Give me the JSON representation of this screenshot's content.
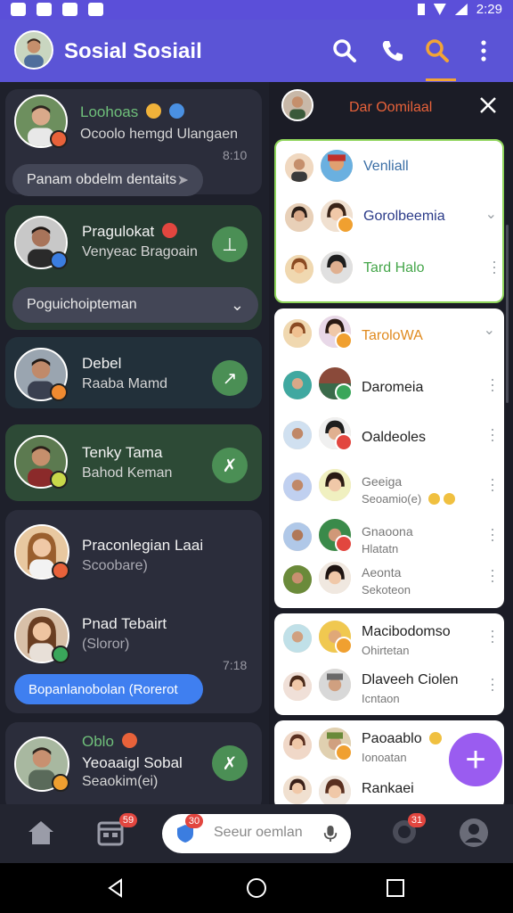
{
  "status_bar": {
    "time": "2:29"
  },
  "app_bar": {
    "title": "Sosial Sosiail"
  },
  "left_chats": [
    {
      "name": "Loohoas",
      "subtitle": "Ocoolo hemgd Ulangaen",
      "time": "8:10",
      "pill": "Panam obdelm dentaits"
    },
    {
      "name": "Pragulokat",
      "subtitle": "Venyeac Bragoain",
      "dropdown": "Poguichoipteman"
    },
    {
      "name": "Debel",
      "subtitle": "Raaba Mamd"
    },
    {
      "name": "Tenky Tama",
      "subtitle": "Bahod Keman"
    },
    {
      "name": "Praconlegian Laai",
      "subtitle": "Scoobare)"
    },
    {
      "name": "Pnad Tebairt",
      "subtitle": "(Sloror)",
      "time": "7:18",
      "pill": "Bopanlanobolan (Rorerot"
    },
    {
      "name": "Oblo",
      "subtitle": "Yeoaaigl Sobal",
      "subtitle2": "Seaokim(ei)"
    }
  ],
  "right_panel": {
    "header_title": "Dar Oomilaal",
    "group1": [
      {
        "name": "Venliall",
        "name_color": "#3a6ea5"
      },
      {
        "name": "Gorolbeemia",
        "name_color": "#2a3a88"
      },
      {
        "name": "Tard Halo",
        "name_color": "#45a64a"
      }
    ],
    "group2": [
      {
        "name": "TaroloWA",
        "name_color": "#e08a1e"
      },
      {
        "name": "Daromeia",
        "name_color": "#222222"
      },
      {
        "name": "Oaldeoles",
        "name_color": "#222222"
      },
      {
        "name": "Geeiga",
        "sub": "Seoamio(e)",
        "name_color": "#777777"
      },
      {
        "name": "Gnaoona",
        "sub": "Hlatatn",
        "name_color": "#777777"
      },
      {
        "name": "Aeonta",
        "sub": "Sekoteon",
        "name_color": "#777777"
      }
    ],
    "group3": [
      {
        "name": "Macibodomso",
        "sub": "Ohirtetan"
      },
      {
        "name": "Dlaveeh Ciolen",
        "sub": "Icntaon"
      }
    ],
    "group4": [
      {
        "name": "Paoaablo",
        "sub": "Ionoatan"
      },
      {
        "name": "Rankaei",
        "sub": ""
      }
    ]
  },
  "bottom_nav": {
    "search_placeholder": "Seeur oemlan",
    "badge_a": "30",
    "badge_b": "59",
    "badge_c": "31"
  },
  "colors": {
    "accent": "#5b54d6",
    "fab": "#9a5cf0",
    "green_button": "#4b8f55",
    "badge": "#e2463f"
  }
}
